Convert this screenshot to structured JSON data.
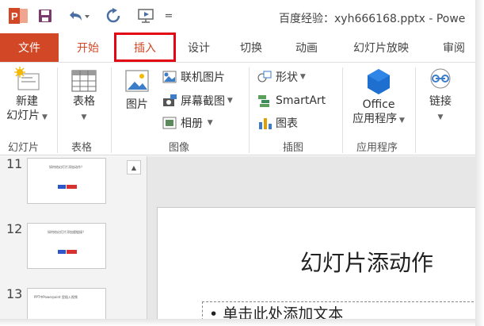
{
  "title_bar": {
    "document_title": "百度经验：xyh666168.pptx - Powe",
    "quick_access": {
      "app_icon": "powerpoint-logo-icon",
      "save_icon": "save-icon",
      "undo_icon": "undo-icon",
      "redo_icon": "redo-icon",
      "present_icon": "start-from-beginning-icon",
      "customize_glyph": "="
    }
  },
  "tabs": [
    {
      "label": "文件"
    },
    {
      "label": "开始"
    },
    {
      "label": "插入",
      "active": true
    },
    {
      "label": "设计"
    },
    {
      "label": "切换"
    },
    {
      "label": "动画"
    },
    {
      "label": "幻灯片放映"
    },
    {
      "label": "审阅"
    }
  ],
  "ribbon": {
    "slides": {
      "new_slide_line1": "新建",
      "new_slide_line2": "幻灯片",
      "group_label": "幻灯片"
    },
    "tables": {
      "table_label": "表格",
      "group_label": "表格"
    },
    "images": {
      "picture_label": "图片",
      "online_pictures": "联机图片",
      "screenshot": "屏幕截图",
      "album": "相册",
      "group_label": "图像"
    },
    "illustrations": {
      "shapes": "形状",
      "smartart": "SmartArt",
      "chart": "图表",
      "group_label": "插图"
    },
    "apps": {
      "office_line1": "Office",
      "office_line2": "应用程序",
      "group_label": "应用程序"
    },
    "links": {
      "link_label": "链接"
    }
  },
  "slide_panel": {
    "slides": [
      {
        "number": "11",
        "title": "如何给幻灯片添加动作？"
      },
      {
        "number": "12",
        "title": "如何给幻灯片添加超链接？"
      },
      {
        "number": "13",
        "title": "PPT中Powerpoint 里插入视频"
      }
    ],
    "scroll_up_glyph": "▲"
  },
  "editor": {
    "slide_title": "幻灯片添动作",
    "content_placeholder": "• 单击此处添加文本"
  },
  "colors": {
    "accent": "#d24726",
    "highlight_box": "#e30613"
  }
}
